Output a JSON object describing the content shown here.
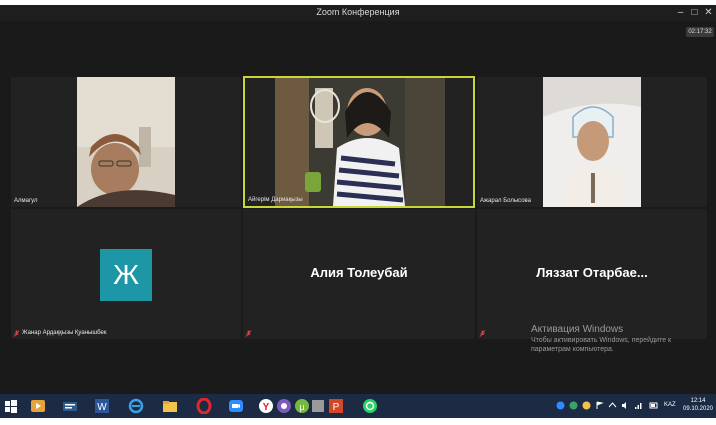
{
  "window": {
    "title": "Zoom Конференция",
    "timer": "02:17:32"
  },
  "participants": [
    {
      "name": "Алмагул",
      "video": true
    },
    {
      "name": "Айгерім Дариақызы",
      "video": true,
      "active_speaker": true
    },
    {
      "name": "Ажарал Болысова",
      "video": true
    },
    {
      "name": "Жанар Ардаққызы Қуанышбек",
      "video": false,
      "avatar_letter": "Ж",
      "avatar_color": "#1d97a6",
      "muted": true
    },
    {
      "name": "Алия Толеубай",
      "video": false,
      "muted": true
    },
    {
      "name": "Ляззат  Отарбае...",
      "video": false,
      "muted": true
    }
  ],
  "watermark": {
    "title": "Активация Windows",
    "line1": "Чтобы активировать Windows, перейдите к",
    "line2": "параметрам компьютера."
  },
  "taskbar": {
    "apps": [
      "windows-start",
      "media-player",
      "app-3",
      "word",
      "internet-explorer",
      "file-explorer",
      "opera",
      "zoom",
      "yandex-browser",
      "viber",
      "utorrent",
      "app-12",
      "powerpoint",
      "whatsapp"
    ],
    "language": "KAZ",
    "time": "12:14",
    "date": "09.10.2020"
  },
  "colors": {
    "active_speaker_border": "#c9d63a",
    "taskbar": "#1c2b43",
    "meeting_bg": "#1a1a1a",
    "tile_bg": "#222222"
  }
}
